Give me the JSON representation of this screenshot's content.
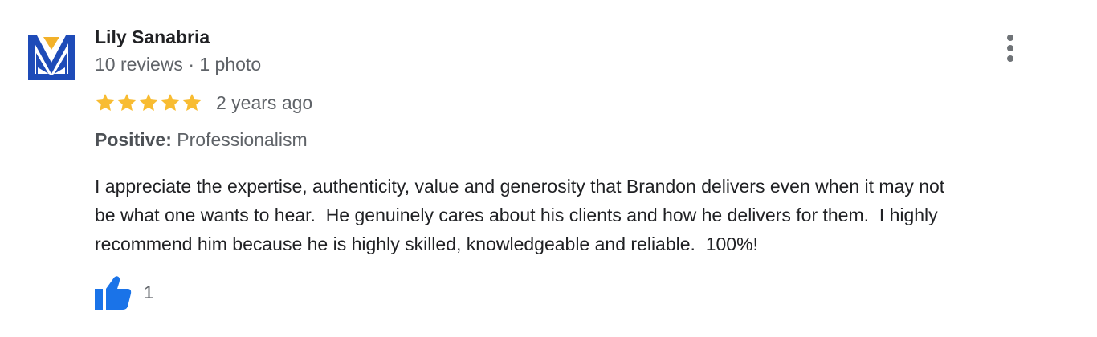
{
  "review": {
    "author": {
      "name": "Lily Sanabria",
      "meta": "10 reviews · 1 photo",
      "avatar_icon": "m-monogram-logo"
    },
    "rating": 5,
    "max_rating": 5,
    "time_ago": "2 years ago",
    "attributes": {
      "label": "Positive:",
      "value": "Professionalism"
    },
    "text": "I appreciate the expertise, authenticity, value and generosity that Brandon delivers even when it may not\nbe what one wants to hear.  He genuinely cares about his clients and how he delivers for them.  I highly\nrecommend him because he is highly skilled, knowledgeable and reliable.  100%!",
    "likes": "1",
    "like_icon": "thumbs-up-icon",
    "more_icon": "more-vert-icon"
  },
  "colors": {
    "star": "#f8bc32",
    "like": "#1a73e8",
    "logo_blue": "#1e4bb8",
    "logo_gold": "#f2b12a"
  }
}
